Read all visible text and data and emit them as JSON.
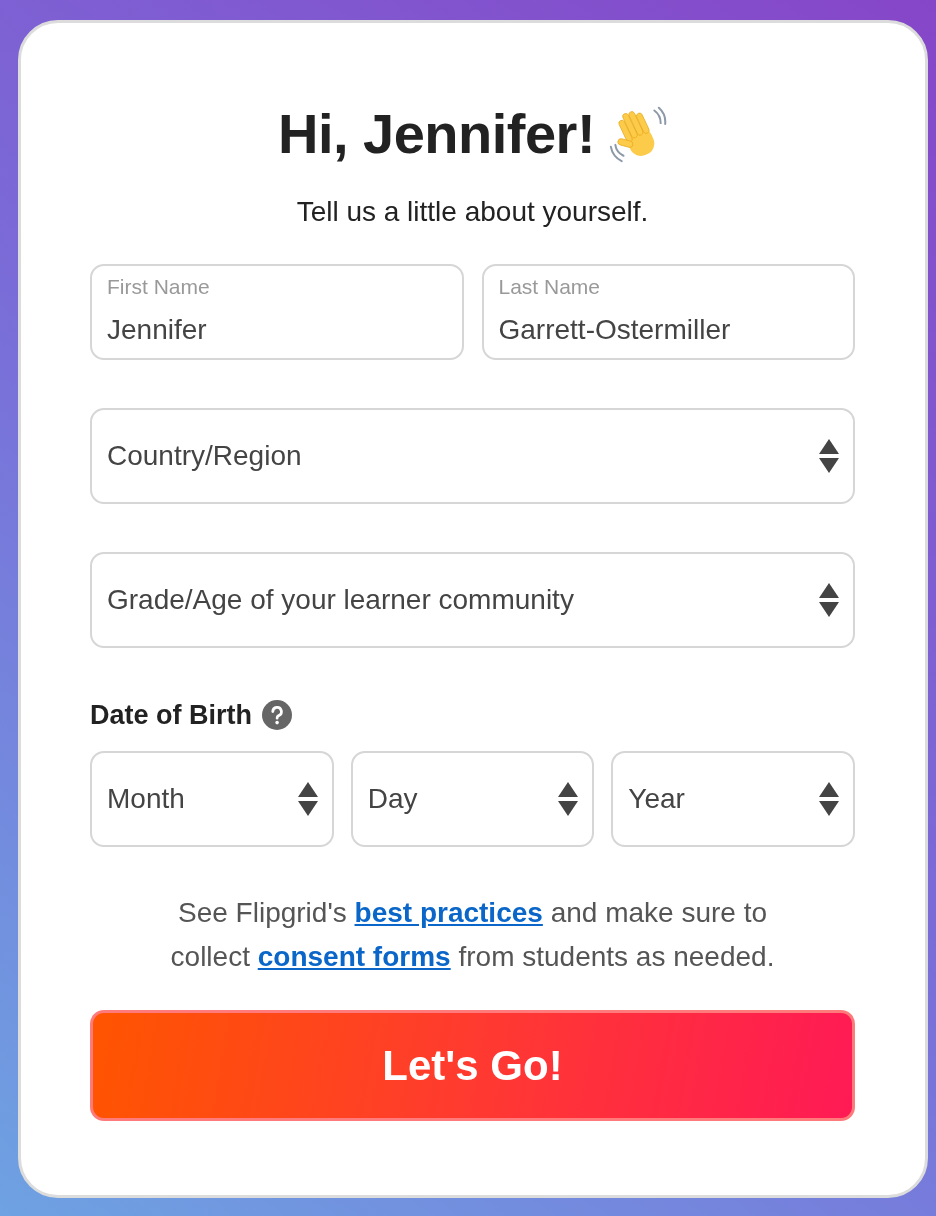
{
  "header": {
    "title": "Hi, Jennifer!",
    "subtitle": "Tell us a little about yourself."
  },
  "name_fields": [
    {
      "label": "First Name",
      "value": "Jennifer"
    },
    {
      "label": "Last Name",
      "value": "Garrett-Ostermiller"
    }
  ],
  "dropdowns": [
    {
      "placeholder": "Country/Region"
    },
    {
      "placeholder": "Grade/Age of your learner community"
    }
  ],
  "date_of_birth": {
    "label": "Date of Birth",
    "dropdowns": [
      {
        "placeholder": "Month"
      },
      {
        "placeholder": "Day"
      },
      {
        "placeholder": "Year"
      }
    ]
  },
  "notice": [
    {
      "kind": "text",
      "text": "See Flipgrid's "
    },
    {
      "kind": "link",
      "text": "best practices"
    },
    {
      "kind": "text",
      "text": " and make sure to collect "
    },
    {
      "kind": "link",
      "text": "consent forms"
    },
    {
      "kind": "text",
      "text": " from students as needed."
    }
  ],
  "submit_button": {
    "label": "Let's Go!"
  }
}
